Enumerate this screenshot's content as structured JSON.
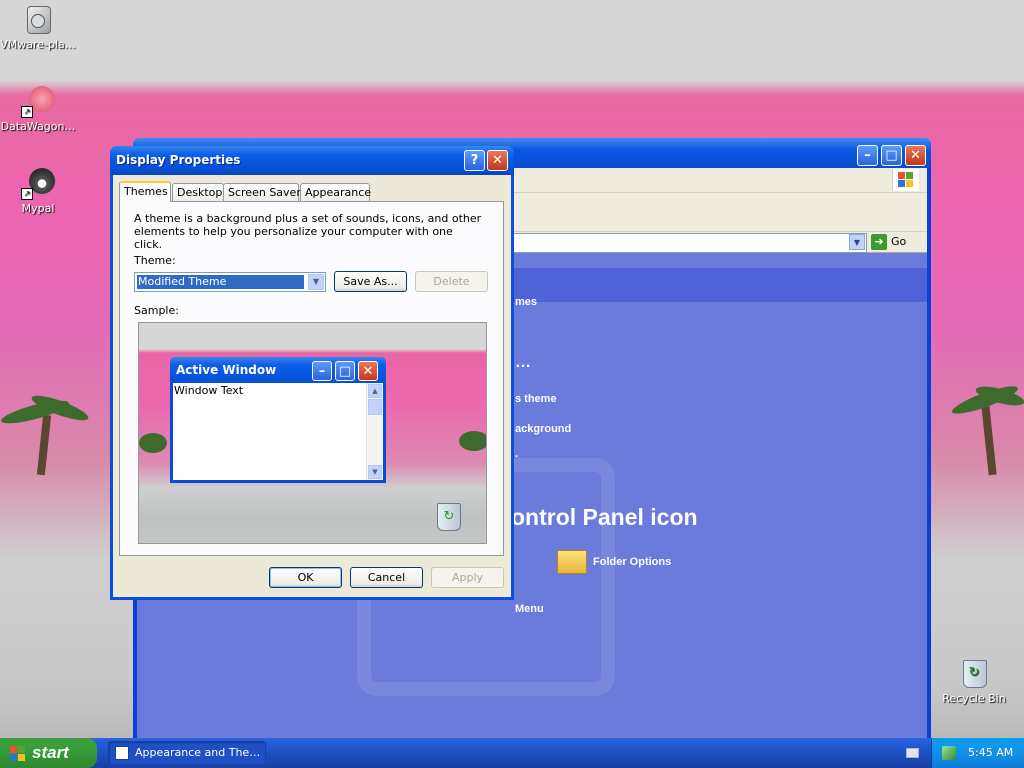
{
  "desktop": {
    "icons": [
      {
        "label": "VMware-pla…",
        "icon": "vmware-installer-icon"
      },
      {
        "label": "DataWagon…",
        "icon": "datawagon-shortcut-icon"
      },
      {
        "label": "Mypal",
        "icon": "mypal-browser-icon"
      },
      {
        "label": "Recycle Bin",
        "icon": "recycle-bin-icon"
      }
    ]
  },
  "background_window": {
    "go_label": "Go",
    "items": [
      "mes",
      "…",
      "s theme",
      "ackground",
      ".",
      "ontrol Panel icon",
      "Folder Options",
      "Menu"
    ]
  },
  "dialog": {
    "title": "Display Properties",
    "tabs": [
      "Themes",
      "Desktop",
      "Screen Saver",
      "Appearance"
    ],
    "active_tab": "Themes",
    "description": "A theme is a background plus a set of sounds, icons, and other elements to help you personalize your computer with one click.",
    "theme_label": "Theme:",
    "theme_value": "Modified Theme",
    "save_as_label": "Save As...",
    "delete_label": "Delete",
    "sample_label": "Sample:",
    "sample_window_title": "Active Window",
    "sample_window_text": "Window Text",
    "ok_label": "OK",
    "cancel_label": "Cancel",
    "apply_label": "Apply"
  },
  "taskbar": {
    "start_label": "start",
    "task_label": "Appearance and The…",
    "clock": "5:45 AM"
  },
  "colors": {
    "xp_blue": "#0a5fe8",
    "dialog_face": "#ece9d8",
    "selection": "#316ac5",
    "start_green": "#3ba23b"
  }
}
